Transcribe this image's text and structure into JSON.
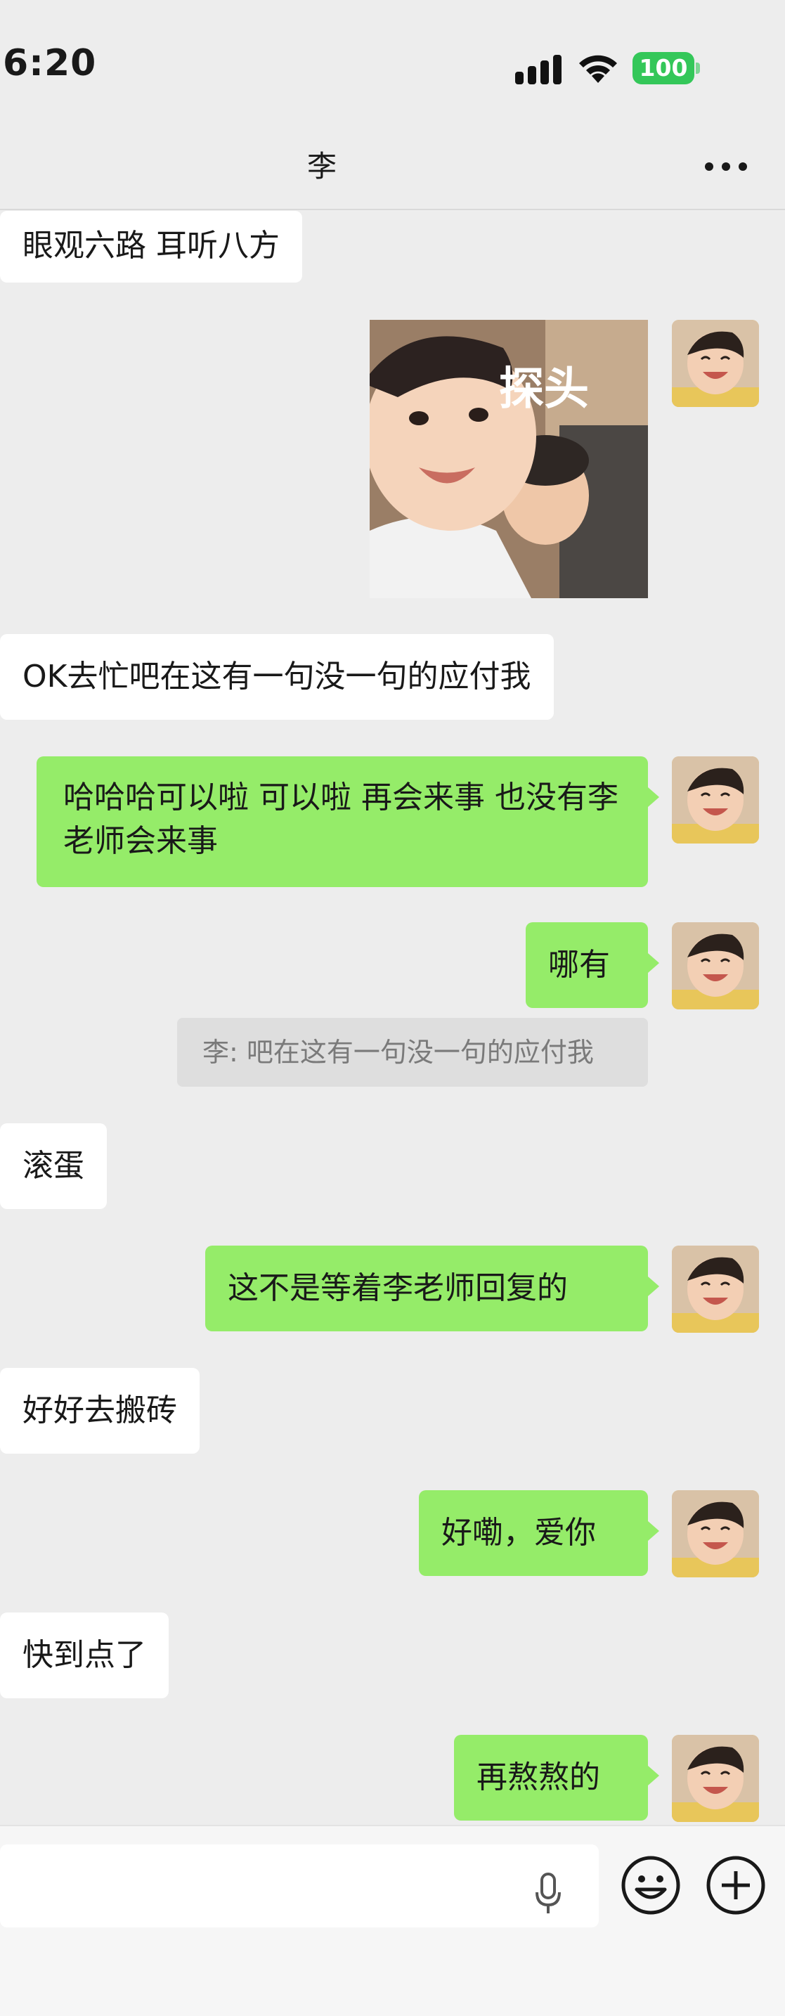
{
  "status_bar": {
    "time": "6:20",
    "battery": "100"
  },
  "header": {
    "title": "李"
  },
  "messages": [
    {
      "text": "眼观六路 耳听八方"
    },
    {
      "sticker_caption": "探头"
    },
    {
      "text": "OK去忙吧在这有一句没一句的应付我"
    },
    {
      "text": "哈哈哈可以啦 可以啦 再会来事 也没有李老师会来事"
    },
    {
      "text": "哪有"
    },
    {
      "text": "滚蛋"
    },
    {
      "text": "这不是等着李老师回复的"
    },
    {
      "text": "好好去搬砖"
    },
    {
      "text": "好嘞，爱你"
    },
    {
      "text": "快到点了"
    },
    {
      "text": "再熬熬的"
    }
  ],
  "quote": {
    "text": "李: 吧在这有一句没一句的应付我"
  },
  "input": {
    "placeholder": ""
  },
  "colors": {
    "outgoing": "#95ec69",
    "incoming": "#ffffff",
    "background": "#ededed",
    "battery": "#34c759"
  },
  "icons": [
    "signal-icon",
    "wifi-icon",
    "battery-icon",
    "more-icon",
    "mic-icon",
    "emoji-icon",
    "plus-icon"
  ]
}
